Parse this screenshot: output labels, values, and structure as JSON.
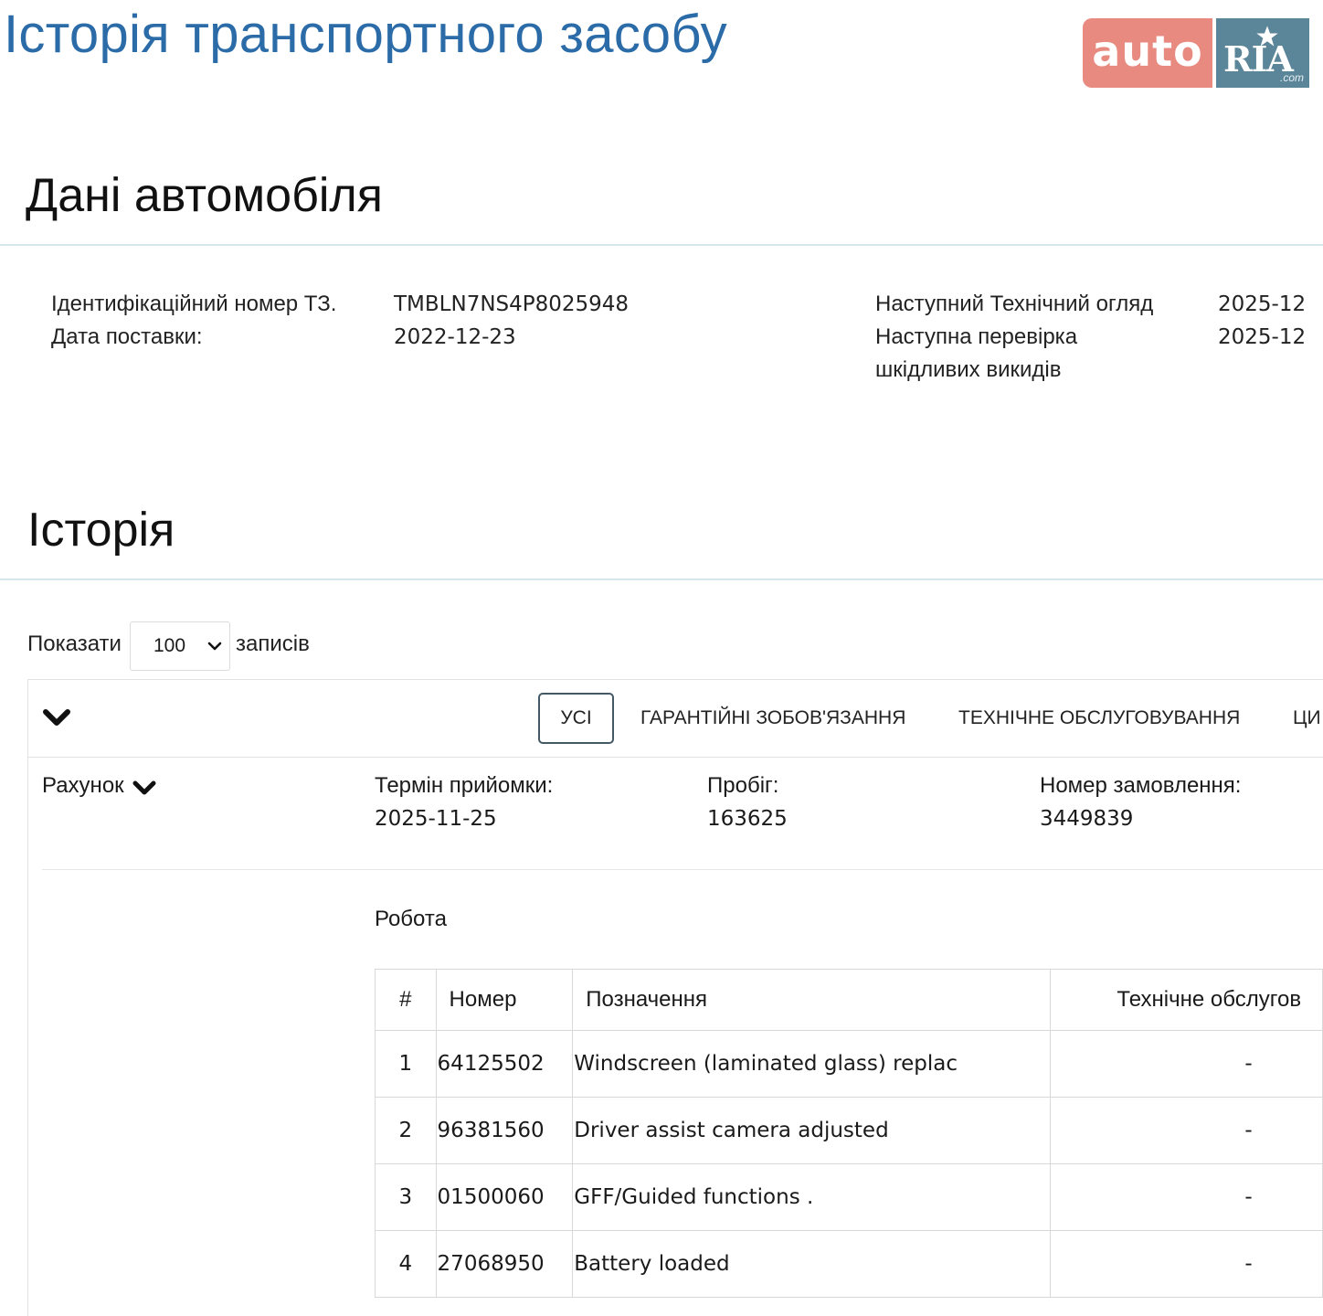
{
  "header": {
    "title": "Історія транспортного засобу",
    "logo": {
      "auto": "auto",
      "ria": "RIA",
      "com": ".com",
      "colors": {
        "auto_bg": "#e88a80",
        "ria_bg": "#5b8699"
      }
    }
  },
  "vehicle": {
    "section_title": "Дані автомобіля",
    "vin_label": "Ідентифікаційний номер ТЗ.",
    "vin": "TMBLN7NS4P8025948",
    "delivery_label": "Дата поставки:",
    "delivery_date": "2022-12-23",
    "next_inspection_label": "Наступний Технічний огляд",
    "next_inspection": "2025-12",
    "next_emission_label_line1": "Наступна перевірка",
    "next_emission_label_line2": "шкідливих викидів",
    "next_emission": "2025-12"
  },
  "history": {
    "section_title": "Історія",
    "show_prefix": "Показати",
    "page_size": "100",
    "show_suffix": "записів",
    "filters": {
      "all": "УСІ",
      "warranty": "ГАРАНТІЙНІ ЗОБОВ'ЯЗАННЯ",
      "maintenance": "ТЕХНІЧНЕ ОБСЛУГОВУВАННЯ",
      "partial": "ЦИ"
    },
    "entry": {
      "invoice_label": "Рахунок",
      "acceptance_label": "Термін прийомки:",
      "acceptance_date": "2025-11-25",
      "mileage_label": "Пробіг:",
      "mileage": "163625",
      "order_label": "Номер замовлення:",
      "order_number": "3449839",
      "work_title": "Робота",
      "columns": {
        "num": "#",
        "code": "Номер",
        "desc": "Позначення",
        "maint": "Технічне обслугов"
      },
      "rows": [
        {
          "num": "1",
          "code": "64125502",
          "desc": "Windscreen (laminated glass) replac",
          "maint": "-"
        },
        {
          "num": "2",
          "code": "96381560",
          "desc": "Driver assist camera adjusted",
          "maint": "-"
        },
        {
          "num": "3",
          "code": "01500060",
          "desc": "GFF/Guided functions .",
          "maint": "-"
        },
        {
          "num": "4",
          "code": "27068950",
          "desc": "Battery loaded",
          "maint": "-"
        }
      ]
    }
  }
}
